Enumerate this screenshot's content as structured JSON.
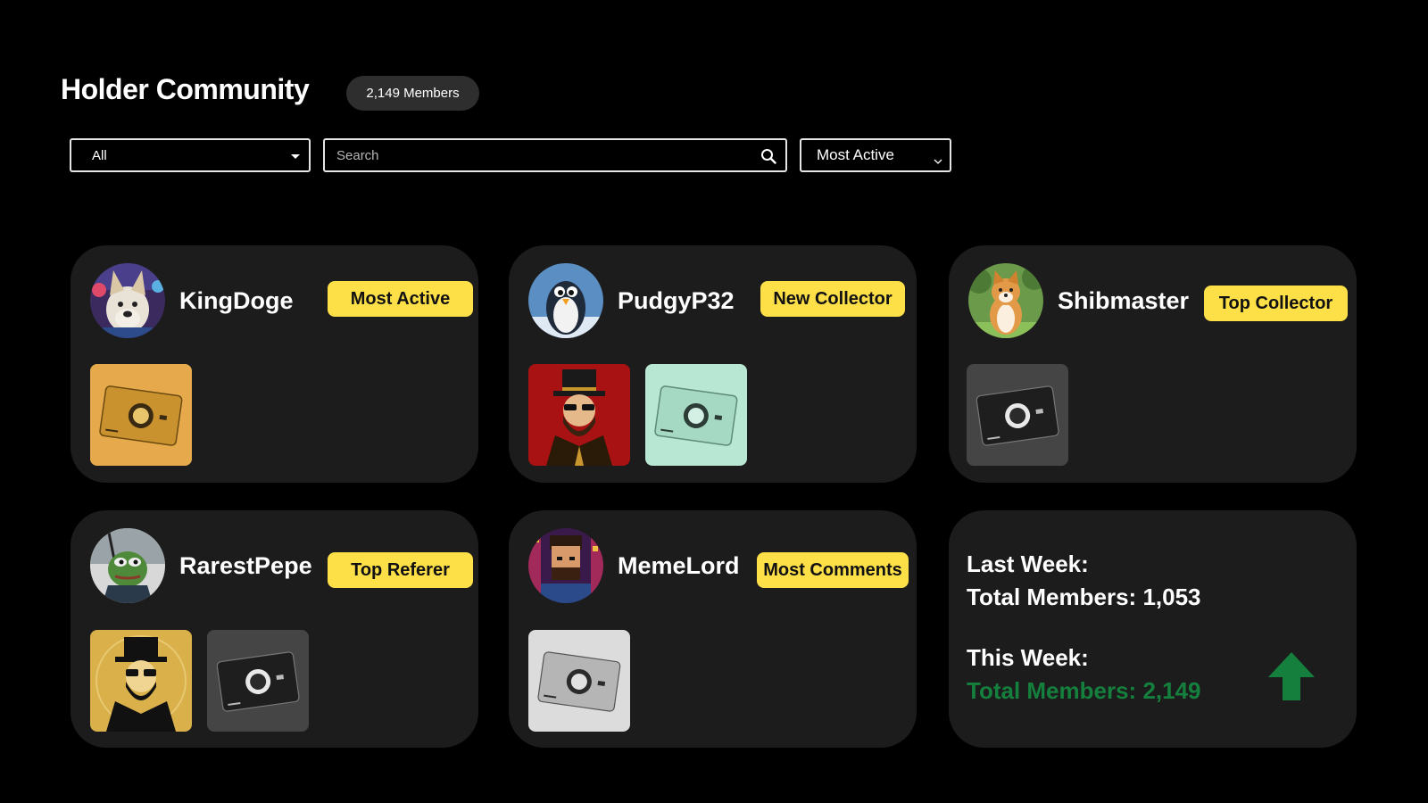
{
  "header": {
    "title": "Holder Community",
    "members_badge": "2,149 Members"
  },
  "filters": {
    "category_value": "All",
    "search_placeholder": "Search",
    "sort_value": "Most Active"
  },
  "members": [
    {
      "name": "KingDoge",
      "badge": "Most Active",
      "avatar": "dog-avatar",
      "nfts": [
        "gold-card-nft"
      ]
    },
    {
      "name": "PudgyP32",
      "badge": "New Collector",
      "avatar": "penguin-avatar",
      "nfts": [
        "top-hat-gentleman-nft",
        "mint-card-nft"
      ]
    },
    {
      "name": "Shibmaster",
      "badge": "Top Collector",
      "avatar": "shiba-avatar",
      "nfts": [
        "black-card-nft"
      ]
    },
    {
      "name": "RarestPepe",
      "badge": "Top Referer",
      "avatar": "pepe-avatar",
      "nfts": [
        "gold-gentleman-nft",
        "black-card-nft"
      ]
    },
    {
      "name": "MemeLord",
      "badge": "Most Comments",
      "avatar": "pixel-man-avatar",
      "nfts": [
        "silver-card-nft"
      ]
    }
  ],
  "stats": {
    "last_week_label": "Last Week:",
    "last_week_total": "Total Members: 1,053",
    "this_week_label": "This Week:",
    "this_week_total": "Total Members: 2,149",
    "growth_color": "#15803d"
  },
  "colors": {
    "background": "#000000",
    "card": "#1c1c1c",
    "badge": "#fde047"
  }
}
